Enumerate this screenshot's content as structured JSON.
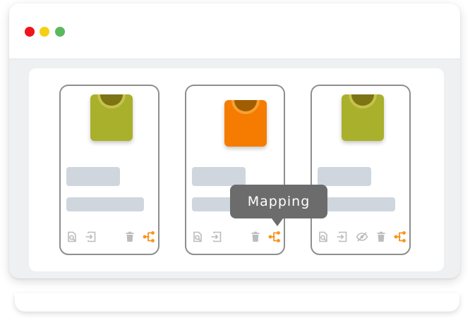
{
  "window": {
    "traffic_lights": [
      {
        "name": "close",
        "color": "#f0141c"
      },
      {
        "name": "minimize",
        "color": "#f6cf12"
      },
      {
        "name": "maximize",
        "color": "#5cb85c"
      }
    ]
  },
  "cards": [
    {
      "thumbnail_color": "#a9b02c",
      "icons": [
        "preview-icon",
        "import-icon",
        "delete-icon",
        "mapping-icon"
      ]
    },
    {
      "thumbnail_color": "#f57c00",
      "icons": [
        "preview-icon",
        "import-icon",
        "delete-icon",
        "mapping-icon"
      ]
    },
    {
      "thumbnail_color": "#a9b02c",
      "icons": [
        "preview-icon",
        "import-icon",
        "hide-icon",
        "delete-icon",
        "mapping-icon"
      ]
    }
  ],
  "tooltip": {
    "label": "Mapping"
  },
  "colors": {
    "accent": "#f7941d",
    "icon_gray": "#bcbcbc",
    "placeholder": "#cfd6dd",
    "card_border": "#8e8e8e"
  }
}
